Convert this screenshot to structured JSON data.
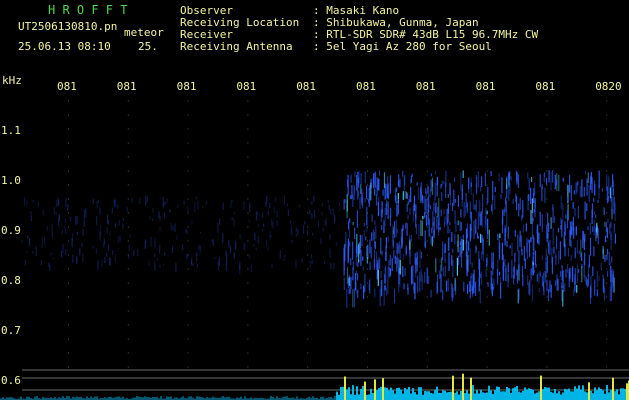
{
  "header": {
    "logo": "H R O F F T",
    "filename": "UT2506130810.pn",
    "tag": "meteor",
    "datetime": "25.06.13 08:10",
    "dt_short": "25.",
    "info_labels": [
      "Observer",
      "Receiving Location",
      "Receiver",
      "Receiving Antenna"
    ],
    "info_values": [
      ": Masaki Kano",
      ": Shibukawa, Gunma, Japan",
      ": RTL-SDR SDR# 43dB L15 96.7MHz CW",
      ": 5el Yagi Az 280 for Seoul"
    ]
  },
  "time_axis": [
    "081",
    "081",
    "081",
    "081",
    "081",
    "081",
    "081",
    "081",
    "081",
    "0820"
  ],
  "freq_axis": {
    "unit": "kHz",
    "ticks": [
      "1.1",
      "1.0",
      "0.9",
      "0.8",
      "0.7",
      "0.6"
    ]
  },
  "colors": {
    "text": "#f4f4a0",
    "logo": "#4cd94c",
    "signal": "#2f5cff",
    "hot": "#5ad9ff",
    "bar": "#00c8ff",
    "bar_peak": "#ffff40",
    "guide": "#6c6c6c"
  }
}
